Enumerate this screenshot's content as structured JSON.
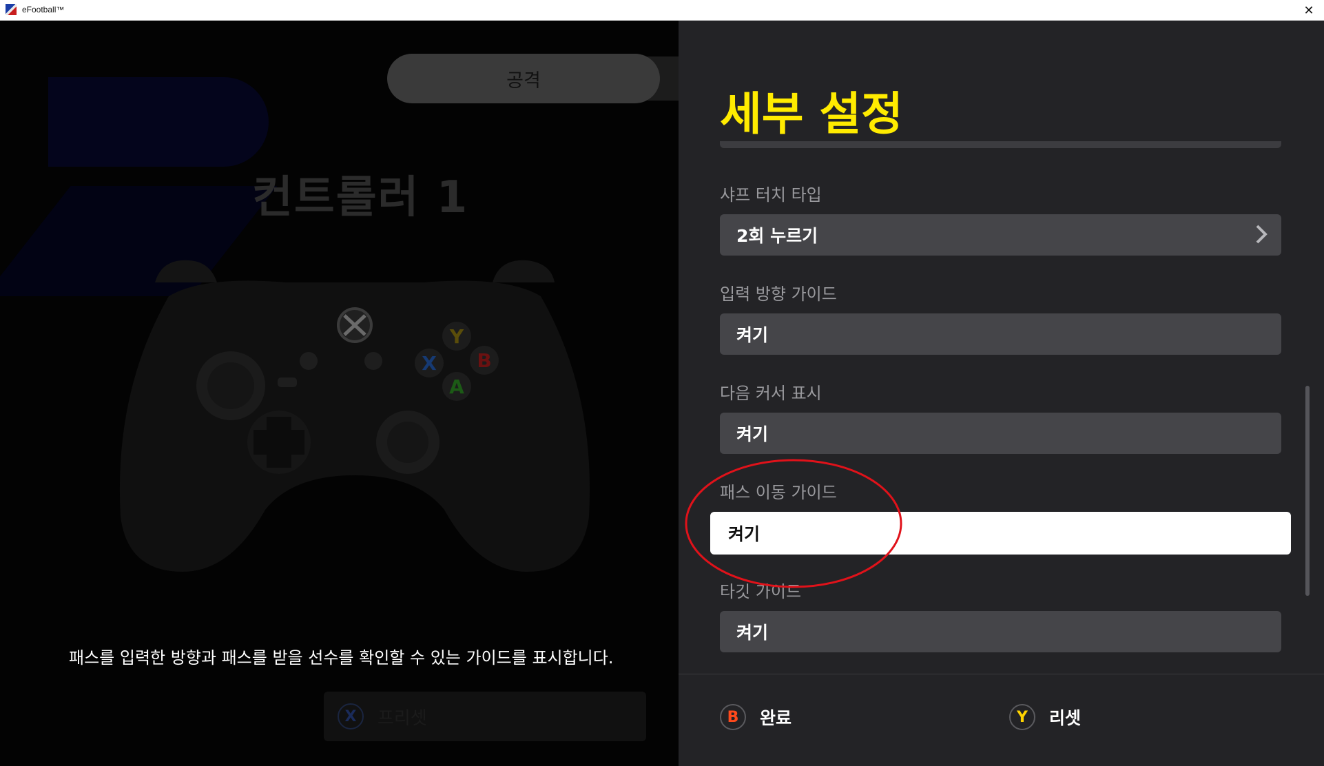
{
  "window": {
    "title": "eFootball™",
    "close_glyph": "✕"
  },
  "left": {
    "tab_label": "공격",
    "controller_title": "컨트롤러 1",
    "description": "패스를 입력한 방향과 패스를 받을 선수를 확인할 수 있는 가이드를 표시합니다.",
    "preset": {
      "button_glyph": "X",
      "label": "프리셋"
    },
    "controller_buttons": {
      "y": "Y",
      "x": "X",
      "b": "B",
      "a": "A"
    }
  },
  "panel": {
    "title": "세부 설정",
    "settings": [
      {
        "label": "샤프 터치 타입",
        "value": "2회 누르기",
        "has_chevron": true
      },
      {
        "label": "입력 방향 가이드",
        "value": "켜기"
      },
      {
        "label": "다음 커서 표시",
        "value": "켜기"
      },
      {
        "label": "패스 이동 가이드",
        "value": "켜기",
        "selected": true
      },
      {
        "label": "타깃 가이드",
        "value": "켜기"
      }
    ]
  },
  "footer": {
    "done": {
      "glyph": "B",
      "label": "완료"
    },
    "reset": {
      "glyph": "Y",
      "label": "리셋"
    }
  },
  "icons": [
    "efootball-app-icon",
    "close-icon",
    "xbox-controller-icon",
    "chevron-right-icon"
  ],
  "colors": {
    "title_yellow": "#ffeb00",
    "panel_bg": "#232326",
    "selected_bg": "#ffffff",
    "annotation_red": "#e0121a",
    "b_button": "#ff4a1c",
    "y_button": "#ffd400"
  }
}
